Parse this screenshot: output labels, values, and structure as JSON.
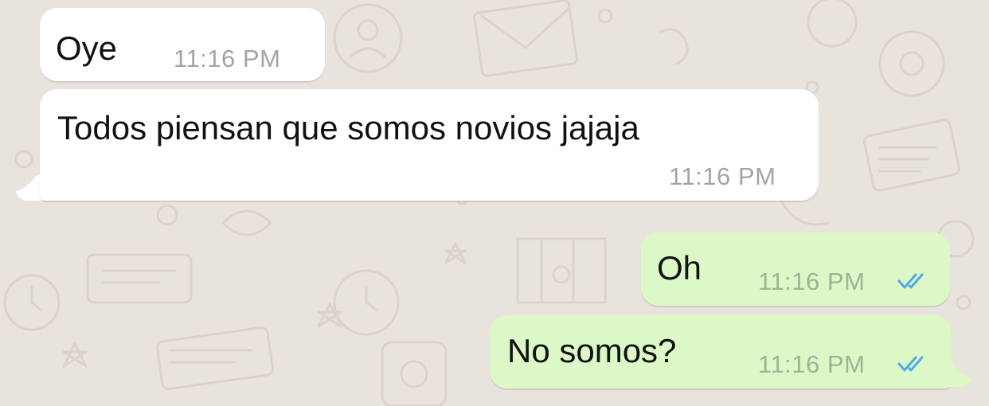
{
  "chat": {
    "messages": [
      {
        "direction": "incoming",
        "text": "Oye",
        "time": "11:16 PM"
      },
      {
        "direction": "incoming",
        "text": "Todos piensan que somos novios jajaja",
        "time": "11:16 PM"
      },
      {
        "direction": "outgoing",
        "text": "Oh",
        "time": "11:16 PM",
        "status_icon": "double-check-icon"
      },
      {
        "direction": "outgoing",
        "text": "No somos?",
        "time": "11:16 PM",
        "status_icon": "double-check-icon"
      }
    ]
  },
  "colors": {
    "background": "#e8e3dc",
    "incoming_bubble": "#ffffff",
    "outgoing_bubble": "#dcf8c6",
    "read_ticks": "#4fa9e8"
  }
}
